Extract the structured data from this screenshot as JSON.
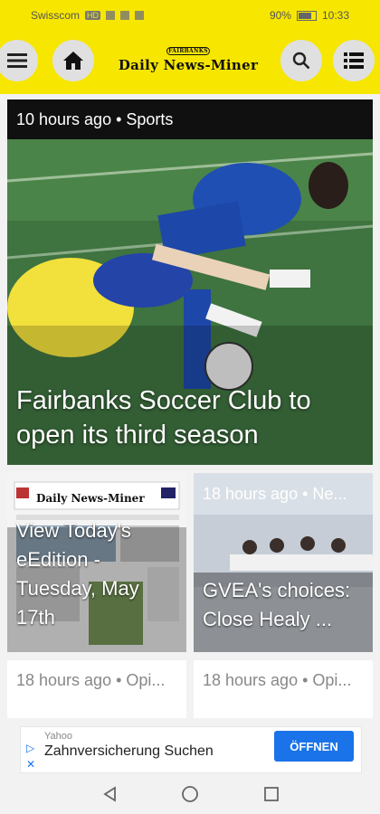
{
  "status_bar": {
    "carrier": "Swisscom",
    "network_badge": "HD",
    "battery": "90%",
    "time": "10:33"
  },
  "app_bar": {
    "logo_text": "Daily News-Miner",
    "logo_small": "FAIRBANKS",
    "icons": {
      "menu": "hamburger-icon",
      "home": "home-icon",
      "search": "search-icon",
      "sections": "list-icon"
    }
  },
  "hero": {
    "meta": "10 hours ago • Sports",
    "title": "Fairbanks Soccer Club to open its third season"
  },
  "cards": [
    {
      "meta": "",
      "title": "View Today's eEdition - Tuesday, May 17th"
    },
    {
      "meta": "18 hours ago • Ne...",
      "title": "GVEA's choices: Close Healy ..."
    }
  ],
  "opinion_cards": [
    {
      "meta": "18 hours ago • Opi..."
    },
    {
      "meta": "18 hours ago • Opi..."
    }
  ],
  "ad": {
    "sponsor": "Yahoo",
    "text": "Zahnversicherung Suchen",
    "button": "ÖFFNEN"
  },
  "colors": {
    "brand_yellow": "#f7e600",
    "card_dark": "#101010",
    "ad_button": "#1a73e8"
  }
}
